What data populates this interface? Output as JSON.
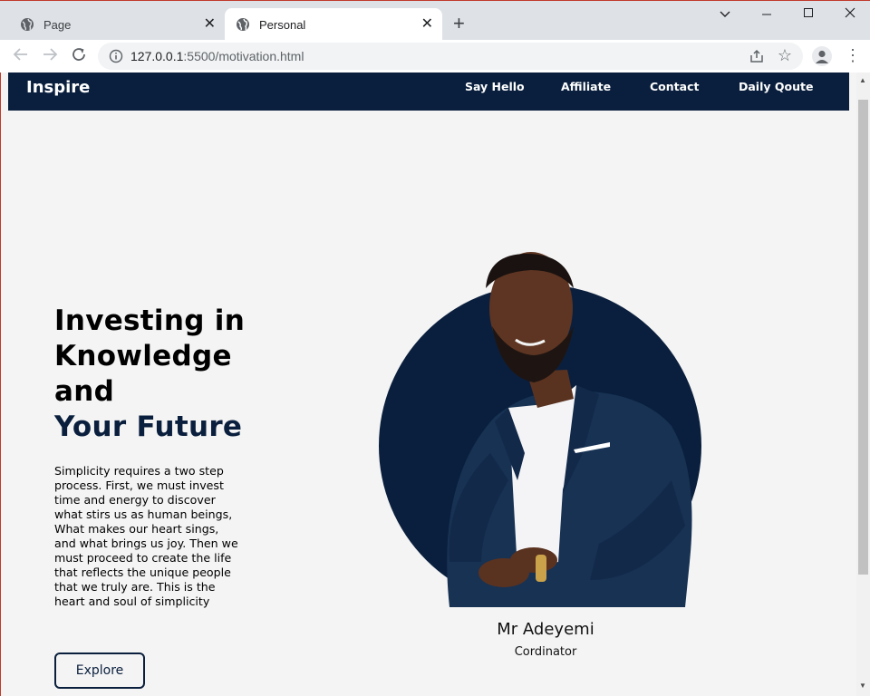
{
  "browser": {
    "tabs": [
      {
        "title": "Page"
      },
      {
        "title": "Personal"
      }
    ],
    "url_host": "127.0.0.1",
    "url_path": ":5500/motivation.html"
  },
  "site": {
    "brand": "Inspire",
    "nav": [
      "Say Hello",
      "Affiliate",
      "Contact",
      "Daily Qoute"
    ],
    "colors": {
      "accent": "#0a1f3d",
      "background": "#f4f4f4"
    }
  },
  "hero": {
    "title_lines": [
      "Investing in",
      "Knowledge",
      "and"
    ],
    "title_accent": "Your Future",
    "body_lines": [
      "Simplicity requires a two step",
      "process. First, we must invest",
      "time and energy to discover",
      "what stirs us as human beings,",
      "What makes our heart sings,",
      "and what brings us joy. Then we",
      "must proceed to create the life",
      "that reflects the unique people",
      "that we truly are. This is the",
      "heart and soul of simplicity"
    ],
    "button": "Explore"
  },
  "profile": {
    "name": "Mr Adeyemi",
    "role": "Cordinator"
  }
}
